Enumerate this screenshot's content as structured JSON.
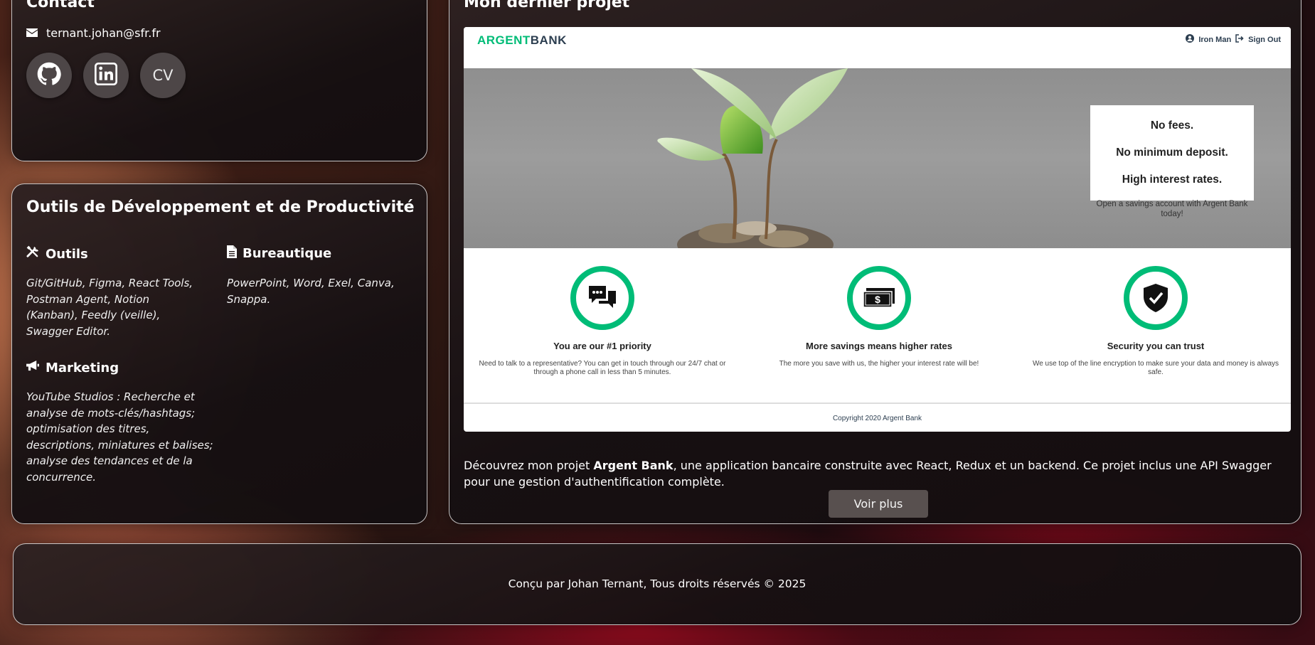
{
  "contact": {
    "title": "Contact",
    "email": "ternant.johan@sfr.fr",
    "cv_label": "CV"
  },
  "tools": {
    "title": "Outils de Développement et de Productivité",
    "sections": [
      {
        "title": "Outils",
        "text": "Git/GitHub, Figma, React Tools, Postman Agent, Notion (Kanban), Feedly (veille), Swagger Editor."
      },
      {
        "title": "Bureautique",
        "text": "PowerPoint, Word, Exel, Canva, Snappa."
      },
      {
        "title": "Marketing",
        "text": "YouTube Studios : Recherche et analyse de mots-clés/hashtags; optimisation des titres, descriptions, miniatures et balises; analyse des tendances et de la concurrence."
      }
    ]
  },
  "project": {
    "title": "Mon dernier projet",
    "mockup": {
      "logo_part1": "ARGENT",
      "logo_part2": "BANK",
      "user": "Iron Man",
      "signout": "Sign Out",
      "hero_line1": "No fees.",
      "hero_line2": "No minimum deposit.",
      "hero_line3": "High interest rates.",
      "hero_sub": "Open a savings account with Argent Bank today!",
      "features": [
        {
          "title": "You are our #1 priority",
          "text": "Need to talk to a representative? You can get in touch through our 24/7 chat or through a phone call in less than 5 minutes."
        },
        {
          "title": "More savings means higher rates",
          "text": "The more you save with us, the higher your interest rate will be!"
        },
        {
          "title": "Security you can trust",
          "text": "We use top of the line encryption to make sure your data and money is always safe."
        }
      ],
      "footer": "Copyright 2020 Argent Bank"
    },
    "desc_before": "Découvrez mon projet ",
    "desc_bold": "Argent Bank",
    "desc_after": ", une application bancaire construite avec React, Redux et un backend. Ce projet inclus une API Swagger pour une gestion d'authentification complète.",
    "button_label": "Voir plus"
  },
  "footer": {
    "text": "Conçu par Johan Ternant, Tous droits réservés © 2025"
  },
  "colors": {
    "accent_green": "#00bc77",
    "button_bg": "#58504f",
    "card_border": "#ffffff"
  }
}
